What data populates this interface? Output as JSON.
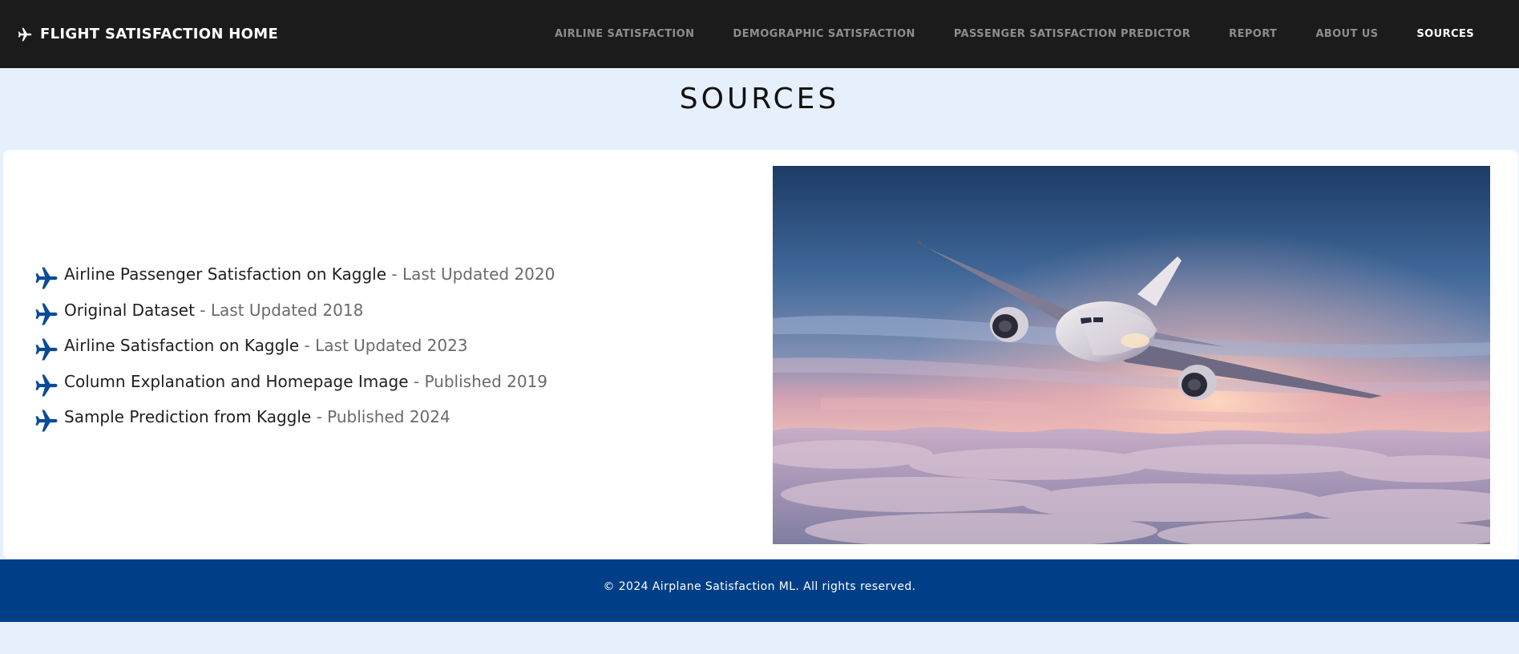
{
  "nav": {
    "brand": "FLIGHT SATISFACTION HOME",
    "brand_icon": "airplane-icon",
    "links": [
      {
        "label": "AIRLINE SATISFACTION",
        "active": false
      },
      {
        "label": "DEMOGRAPHIC SATISFACTION",
        "active": false
      },
      {
        "label": "PASSENGER SATISFACTION PREDICTOR",
        "active": false
      },
      {
        "label": "REPORT",
        "active": false
      },
      {
        "label": "ABOUT US",
        "active": false
      },
      {
        "label": "SOURCES",
        "active": true
      }
    ]
  },
  "page": {
    "title": "SOURCES"
  },
  "sources": [
    {
      "link": "Airline Passenger Satisfaction on Kaggle",
      "note": "Last Updated 2020"
    },
    {
      "link": "Original Dataset",
      "note": "Last Updated 2018"
    },
    {
      "link": "Airline Satisfaction on Kaggle",
      "note": "Last Updated 2023"
    },
    {
      "link": "Column Explanation and Homepage Image",
      "note": "Published 2019"
    },
    {
      "link": "Sample Prediction from Kaggle",
      "note": "Published 2024"
    }
  ],
  "separator": " - ",
  "hero_image": "airplane-above-clouds-photo",
  "footer": {
    "text": "© 2024 Airplane Satisfaction ML. All rights reserved."
  },
  "colors": {
    "navbar_bg": "#1b1b1b",
    "page_bg": "#e6f0fd",
    "footer_bg": "#003f87",
    "bullet_icon": "#0b4a97"
  }
}
